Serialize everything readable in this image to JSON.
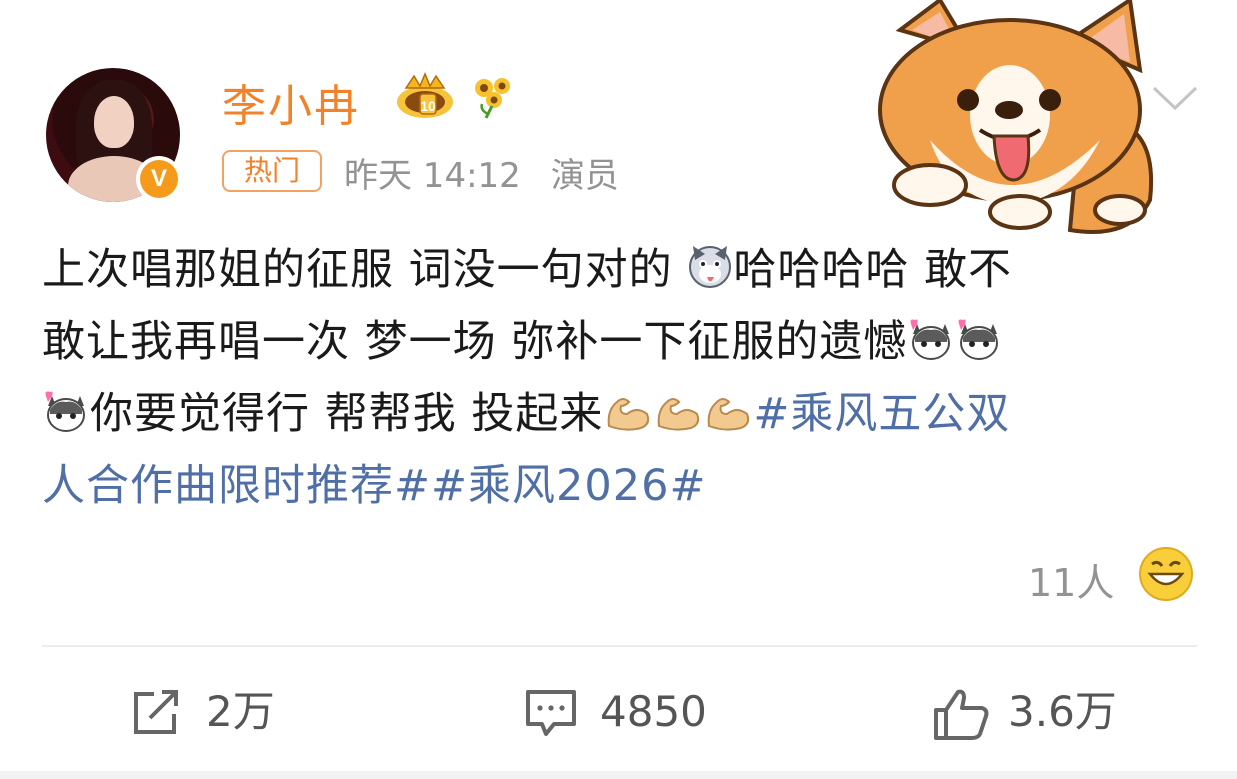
{
  "post": {
    "author": "李小冉",
    "tag": "热门",
    "time": "昨天 14:12",
    "occupation": "演员",
    "verified_badge": "V",
    "content": {
      "line1": "上次唱那姐的征服 词没一句对的",
      "line1b": "哈哈哈哈 敢不",
      "line2": "敢让我再唱一次 梦一场 弥补一下征服的遗憾",
      "line3a": "你要觉得行 帮帮我 投起来",
      "line3_topic": "#乘风五公双",
      "line4_topic": "人合作曲限时推荐##乘风2026#"
    },
    "reactions": {
      "count_text": "11人"
    }
  },
  "actions": {
    "repost": "2万",
    "comment": "4850",
    "like": "3.6万"
  },
  "icons": {
    "crown": "crown-badge-icon",
    "flower": "sunflower-icon",
    "chevron": "chevron-down-icon",
    "sticker": "corgi-sticker",
    "repost": "repost-icon",
    "comment": "comment-icon",
    "like": "thumbs-up-icon",
    "reaction": "grin-emoji-icon"
  },
  "colors": {
    "author": "#f28128",
    "topic": "#4f6fa6",
    "meta": "#939393"
  }
}
